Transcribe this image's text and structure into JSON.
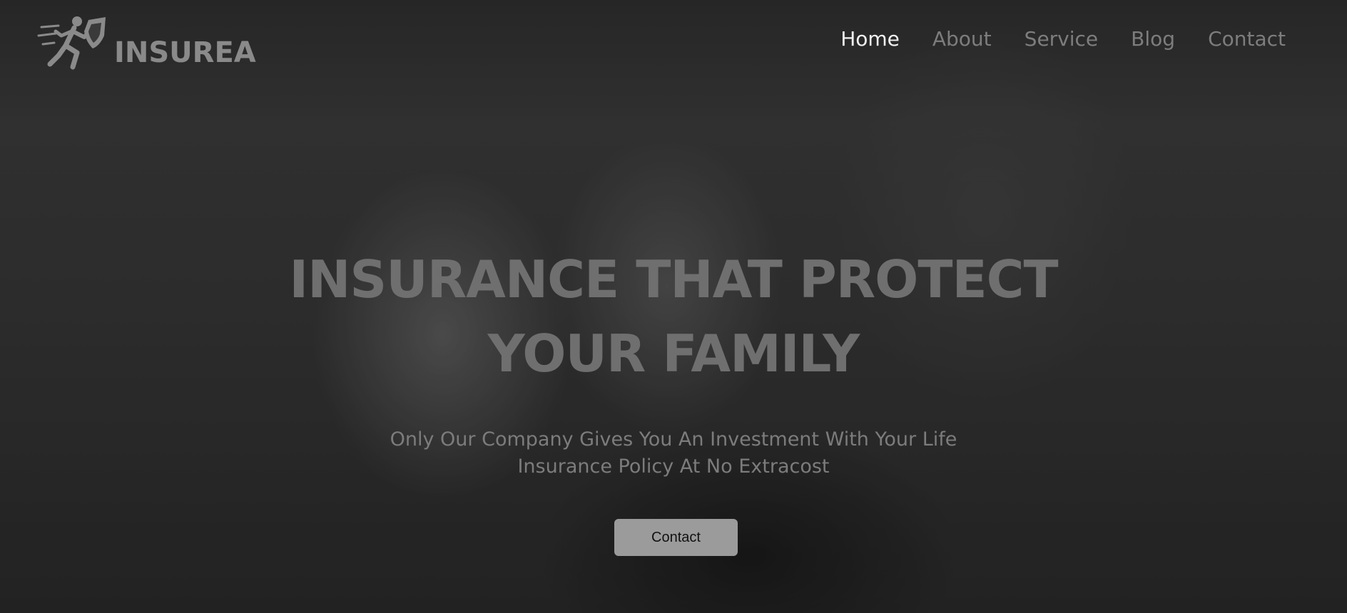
{
  "brand": {
    "name": "INSUREA",
    "logo_icon": "running-man-shield-icon"
  },
  "nav": {
    "items": [
      {
        "label": "Home",
        "active": true
      },
      {
        "label": "About",
        "active": false
      },
      {
        "label": "Service",
        "active": false
      },
      {
        "label": "Blog",
        "active": false
      },
      {
        "label": "Contact",
        "active": false
      }
    ]
  },
  "hero": {
    "headline_line1": "INSURANCE THAT PROTECT",
    "headline_line2": "YOUR FAMILY",
    "subtitle_line1": "Only Our Company Gives You An Investment With Your Life",
    "subtitle_line2": "Insurance Policy At No Extracost",
    "cta_label": "Contact"
  },
  "colors": {
    "nav_active": "#f2f2f2",
    "nav_inactive": "#7d7d7d",
    "headline": "#6f6f6f",
    "button_bg": "#9b9b9b"
  }
}
